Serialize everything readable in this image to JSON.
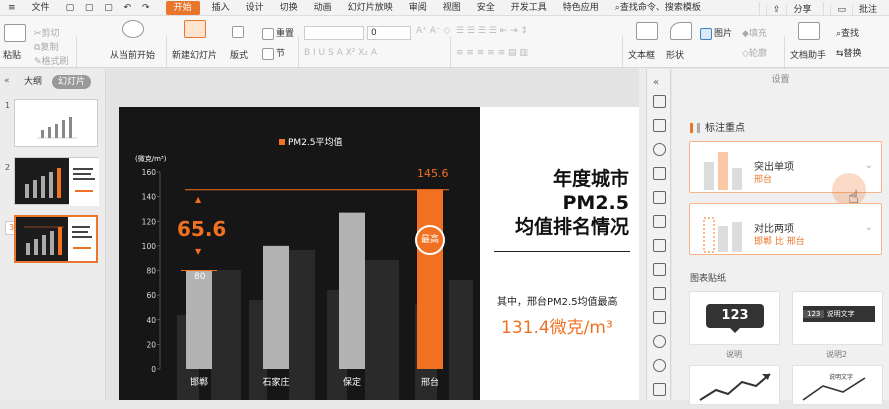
{
  "menubar": {
    "file": "文件",
    "tabs": [
      "开始",
      "插入",
      "设计",
      "切换",
      "动画",
      "幻灯片放映",
      "审阅",
      "视图",
      "安全",
      "开发工具",
      "特色应用"
    ],
    "active_tab": "开始",
    "search": "查找命令、搜索模板",
    "share": "分享",
    "comment": "批注"
  },
  "ribbon": {
    "paste": "粘贴",
    "cut": "剪切",
    "copy": "复制",
    "format_painter": "格式刷",
    "play_from_current": "从当前开始",
    "new_slide": "新建幻灯片",
    "layout": "版式",
    "reset": "重置",
    "section": "节",
    "font_size": "0",
    "textbox": "文本框",
    "shape": "形状",
    "picture": "图片",
    "fill": "填充",
    "outline": "轮廓",
    "find": "查找",
    "replace": "替换",
    "doc_assistant": "文档助手"
  },
  "left_panel": {
    "tabs": [
      "大纲",
      "幻灯片"
    ],
    "active_tab": "幻灯片",
    "slide_numbers": [
      "1",
      "2",
      "3"
    ]
  },
  "slide": {
    "legend": "PM2.5平均值",
    "unit": "(微克/m³)",
    "title_lines": [
      "年度城市",
      "PM2.5",
      "均值排名情况"
    ],
    "desc": "其中，邢台PM2.5均值最高",
    "highlight": "131.4微克/m³",
    "annotation_diff": "65.6",
    "target_value": "145.6",
    "badge": "最高",
    "bar_label_first": "80"
  },
  "chart_data": {
    "type": "bar",
    "categories": [
      "邯郸",
      "石家庄",
      "保定",
      "邢台"
    ],
    "values": [
      80,
      100,
      127,
      146
    ],
    "ylabel": "(微克/m³)",
    "ylim": [
      0,
      160
    ],
    "yticks": [
      0,
      20,
      40,
      60,
      80,
      100,
      120,
      140,
      160
    ],
    "reference_line": 145.6,
    "series": [
      {
        "name": "PM2.5平均值",
        "values": [
          80,
          100,
          127,
          146
        ]
      }
    ],
    "colors": {
      "highlight": "#f07122",
      "bar": "#b3b3b3",
      "background": "#161616"
    }
  },
  "pane": {
    "title": "设置",
    "section_label": "标注重点",
    "option1_title": "突出单项",
    "option1_sub": "邢台",
    "option2_title": "对比两项",
    "option2_sub": "邯郸 比 邢台",
    "sticker_label": "图表贴纸",
    "sticker1_label": "说明",
    "sticker1_value": "123",
    "sticker2_label": "说明2",
    "sticker2_value": "123",
    "sticker2_text": "说明文字",
    "sticker3_text": "说明文字"
  },
  "colors": {
    "accent": "#e8762d",
    "orange": "#f07122"
  }
}
